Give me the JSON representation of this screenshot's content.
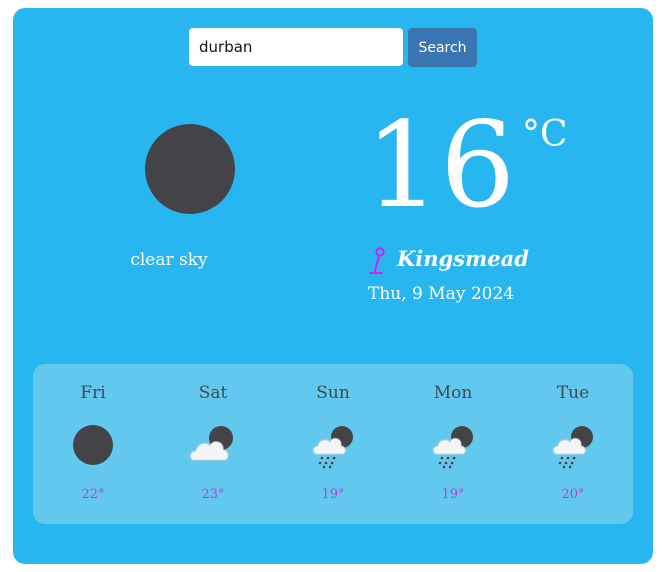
{
  "search": {
    "value": "durban",
    "button_label": "Search"
  },
  "current": {
    "icon": "moon-clear-icon",
    "description": "clear sky",
    "temperature": "16",
    "unit": "°C",
    "location": "Kingsmead",
    "date": "Thu, 9 May 2024"
  },
  "forecast": [
    {
      "day": "Fri",
      "icon": "moon-clear-icon",
      "temp": "22°"
    },
    {
      "day": "Sat",
      "icon": "cloud-moon-icon",
      "temp": "23°"
    },
    {
      "day": "Sun",
      "icon": "rain-cloud-moon-icon",
      "temp": "19°"
    },
    {
      "day": "Mon",
      "icon": "rain-cloud-moon-icon",
      "temp": "19°"
    },
    {
      "day": "Tue",
      "icon": "rain-cloud-moon-icon",
      "temp": "20°"
    }
  ],
  "colors": {
    "card_bg": "#28b6f0",
    "forecast_bg": "#62c8ee",
    "button_bg": "#3a77b2",
    "forecast_temp": "#c23ad6",
    "location_icon": "#d322e6"
  }
}
